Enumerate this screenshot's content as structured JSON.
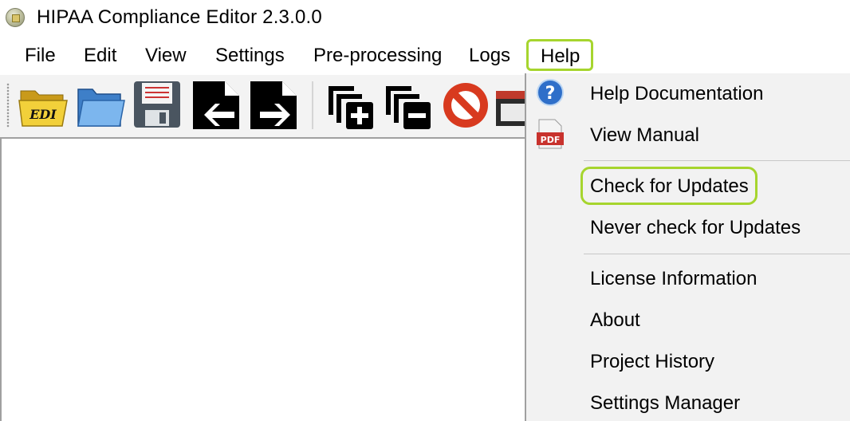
{
  "window": {
    "title": "HIPAA Compliance Editor 2.3.0.0"
  },
  "menubar": {
    "items": [
      "File",
      "Edit",
      "View",
      "Settings",
      "Pre-processing",
      "Logs",
      "Help"
    ],
    "open_menu": "Help"
  },
  "toolbar": {
    "buttons": [
      {
        "icon": "edi-folder-icon",
        "label": "EDI"
      },
      {
        "icon": "open-folder-icon"
      },
      {
        "icon": "save-disk-icon"
      },
      {
        "icon": "import-file-icon"
      },
      {
        "icon": "export-file-icon"
      },
      {
        "icon": "add-copy-icon"
      },
      {
        "icon": "remove-copy-icon"
      },
      {
        "icon": "no-entry-icon"
      },
      {
        "icon": "window-icon"
      }
    ]
  },
  "help_menu": {
    "items": [
      {
        "label": "Help Documentation",
        "icon": "help-question-icon"
      },
      {
        "label": "View Manual",
        "icon": "pdf-icon",
        "icon_text": "PDF"
      },
      {
        "label": "Check for Updates",
        "highlighted": true
      },
      {
        "label": "Never check for Updates"
      },
      {
        "label": "License Information"
      },
      {
        "label": "About"
      },
      {
        "label": "Project History"
      },
      {
        "label": "Settings Manager"
      }
    ]
  },
  "colors": {
    "highlight": "#a6d52e",
    "help_icon": "#2f6fc9",
    "pdf_icon": "#c8322d",
    "no_entry": "#d83a1f"
  }
}
